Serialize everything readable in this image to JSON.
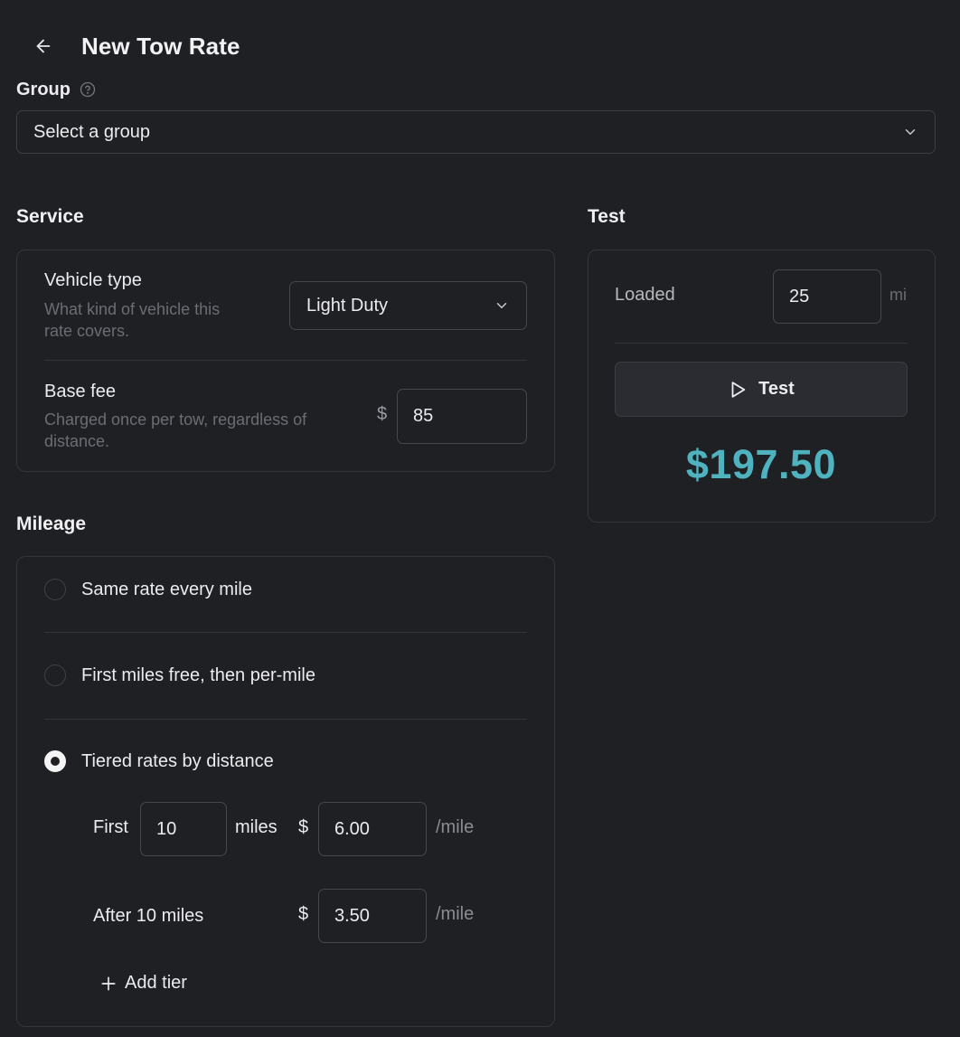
{
  "header": {
    "title": "New Tow Rate"
  },
  "group": {
    "label": "Group",
    "placeholder": "Select a group"
  },
  "service": {
    "heading": "Service",
    "vehicle_type": {
      "title": "Vehicle type",
      "desc_line1": "What kind of vehicle this",
      "desc_line2": "rate covers.",
      "value": "Light Duty"
    },
    "base_fee": {
      "title": "Base fee",
      "desc_line1": "Charged once per tow, regardless of",
      "desc_line2": "distance.",
      "currency": "$",
      "value": "85"
    }
  },
  "mileage": {
    "heading": "Mileage",
    "options": [
      {
        "label": "Same rate every mile",
        "checked": false
      },
      {
        "label": "First miles free, then per-mile",
        "checked": false
      },
      {
        "label": "Tiered rates by distance",
        "checked": true
      }
    ],
    "tiers": [
      {
        "prefix": "First",
        "miles": "10",
        "miles_unit": "miles",
        "currency": "$",
        "rate": "6.00",
        "rate_unit": "/mile"
      },
      {
        "prefix": "After 10 miles",
        "currency": "$",
        "rate": "3.50",
        "rate_unit": "/mile"
      }
    ],
    "add_tier": "Add tier"
  },
  "test": {
    "heading": "Test",
    "loaded_label": "Loaded",
    "loaded_value": "25",
    "loaded_unit": "mi",
    "button_label": "Test",
    "result": "$197.50"
  },
  "colors": {
    "background": "#1f2024",
    "accent": "#4fb2bf",
    "border": "#33353a"
  },
  "icons": [
    "arrow-left-icon",
    "help-circle-icon",
    "chevron-down-icon",
    "play-icon",
    "plus-icon"
  ]
}
